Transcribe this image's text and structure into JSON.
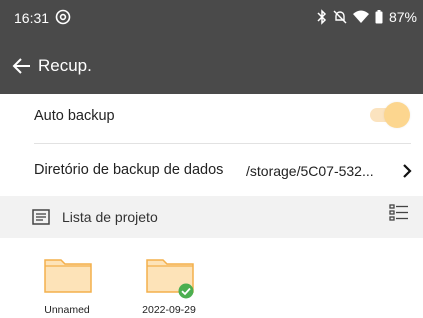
{
  "status_bar": {
    "time": "16:31",
    "battery": "87%"
  },
  "app_bar": {
    "title": "Recup."
  },
  "settings": {
    "auto_backup_label": "Auto backup",
    "auto_backup_on": true,
    "backup_dir_label": "Diretório de backup de dados",
    "backup_dir_value": "/storage/5C07-532..."
  },
  "project_list": {
    "title": "Lista de projeto",
    "items": [
      {
        "name": "Unnamed",
        "synced": false
      },
      {
        "name": "2022-09-29",
        "synced": true
      }
    ]
  },
  "colors": {
    "bar_bg": "#4a4a4a",
    "accent_orange": "#fcd68f",
    "folder_fill": "#fde3b8",
    "folder_stroke": "#f4b04c",
    "check_green": "#4caf50"
  }
}
